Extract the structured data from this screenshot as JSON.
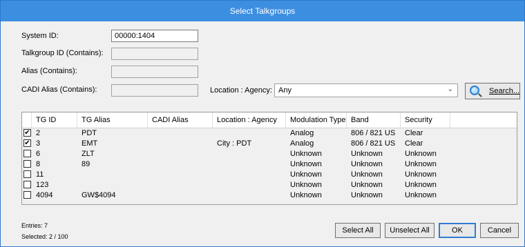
{
  "window": {
    "title": "Select Talkgroups"
  },
  "filters": {
    "system_id_label": "System ID:",
    "system_id_value": "00000:1404",
    "talkgroup_label": "Talkgroup ID (Contains):",
    "alias_label": "Alias (Contains):",
    "cadi_label": "CADI Alias (Contains):",
    "location_label": "Location : Agency:",
    "location_value": "Any",
    "search_label": "Search..."
  },
  "table": {
    "columns": [
      "TG ID",
      "TG Alias",
      "CADI Alias",
      "Location : Agency",
      "Modulation Type",
      "Band",
      "Security"
    ],
    "rows": [
      {
        "checked": true,
        "tg_id": "2",
        "alias": "PDT",
        "cadi": "",
        "location": "",
        "modulation": "Analog",
        "band": "806 / 821 US",
        "security": "Clear"
      },
      {
        "checked": true,
        "tg_id": "3",
        "alias": "EMT",
        "cadi": "",
        "location": "City : PDT",
        "modulation": "Analog",
        "band": "806 / 821 US",
        "security": "Clear"
      },
      {
        "checked": false,
        "tg_id": "6",
        "alias": "ZLT",
        "cadi": "",
        "location": "",
        "modulation": "Unknown",
        "band": "Unknown",
        "security": "Unknown"
      },
      {
        "checked": false,
        "tg_id": "8",
        "alias": "89",
        "cadi": "",
        "location": "",
        "modulation": "Unknown",
        "band": "Unknown",
        "security": "Unknown"
      },
      {
        "checked": false,
        "tg_id": "11",
        "alias": "",
        "cadi": "",
        "location": "",
        "modulation": "Unknown",
        "band": "Unknown",
        "security": "Unknown"
      },
      {
        "checked": false,
        "tg_id": "123",
        "alias": "",
        "cadi": "",
        "location": "",
        "modulation": "Unknown",
        "band": "Unknown",
        "security": "Unknown"
      },
      {
        "checked": false,
        "tg_id": "4094",
        "alias": "GW$4094",
        "cadi": "",
        "location": "",
        "modulation": "Unknown",
        "band": "Unknown",
        "security": "Unknown"
      }
    ]
  },
  "status": {
    "entries": "Entries: 7",
    "selected": "Selected: 2 / 100"
  },
  "buttons": {
    "select_all": "Select All",
    "unselect_all": "Unselect All",
    "ok": "OK",
    "cancel": "Cancel"
  },
  "icons": {
    "search": "search-icon",
    "dropdown": "chevron-down-icon",
    "check": "checkmark-icon"
  },
  "colors": {
    "titlebar": "#3c8ee0",
    "default_button_border": "#2f7bd3"
  }
}
